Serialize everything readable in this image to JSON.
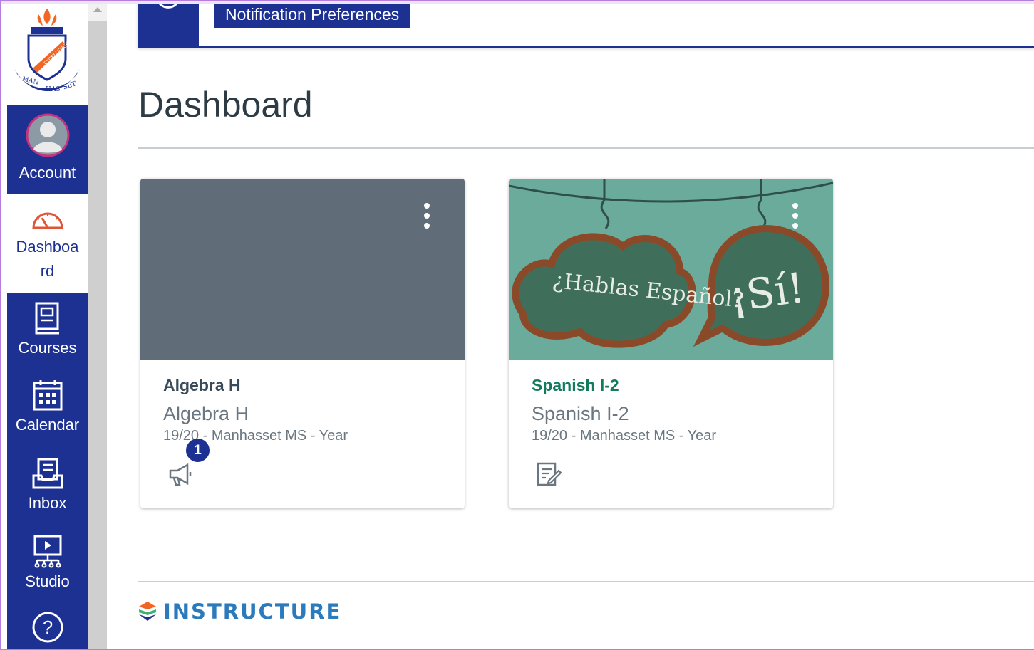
{
  "nav": {
    "items": [
      {
        "label": "Account",
        "icon": "avatar-icon"
      },
      {
        "label": "Dashboard",
        "label_line1": "Dashboa",
        "label_line2": "rd",
        "icon": "dashboard-icon"
      },
      {
        "label": "Courses",
        "icon": "courses-icon"
      },
      {
        "label": "Calendar",
        "icon": "calendar-icon"
      },
      {
        "label": "Inbox",
        "icon": "inbox-icon"
      },
      {
        "label": "Studio",
        "icon": "studio-icon"
      }
    ],
    "help_icon": "help-icon",
    "logo_text": "MANHASSET",
    "logo_banner": "EXCELLENCE"
  },
  "banner": {
    "button_label": "Notification Preferences"
  },
  "page": {
    "title": "Dashboard"
  },
  "cards": [
    {
      "short_name": "Algebra H",
      "long_name": "Algebra H",
      "term": "19/20 - Manhasset MS - Year",
      "hero_color": "#616c79",
      "badge": "1",
      "action_icon": "announcement-icon"
    },
    {
      "short_name": "Spanish I-2",
      "long_name": "Spanish I-2",
      "term": "19/20 - Manhasset MS - Year",
      "hero_color": "#6aab9c",
      "hero_text_left": "¿Hablas Español?",
      "hero_text_right": "¡Sí!",
      "short_name_color": "#127a5e",
      "action_icon": "assignment-icon"
    }
  ],
  "footer": {
    "brand": "INSTRUCTURE"
  }
}
